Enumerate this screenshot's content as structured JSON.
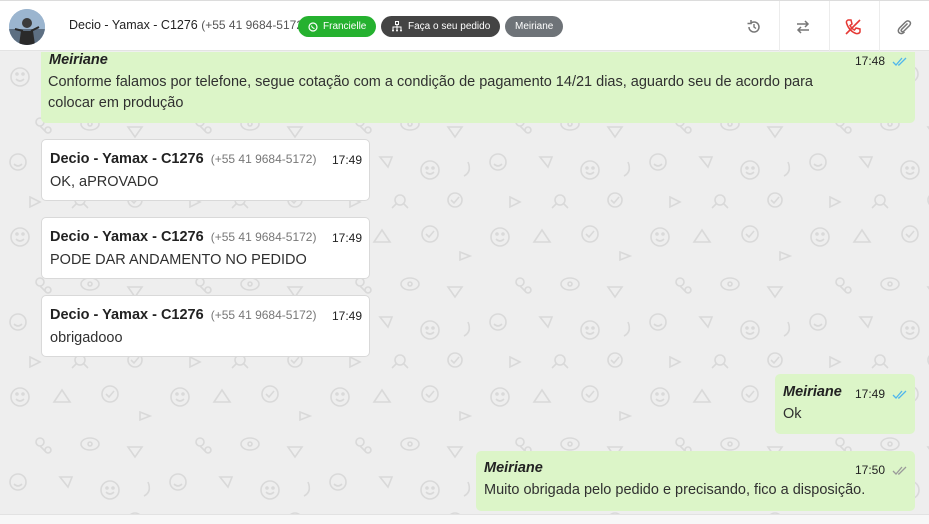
{
  "header": {
    "contact_name": "Decio - Yamax - C1276",
    "contact_phone": "(+55 41 9684-5172)",
    "tags": {
      "whatsapp_agent": "Francielle",
      "order_flow": "Faça o seu pedido",
      "assignee": "Meiriane"
    },
    "icons": [
      "history-icon",
      "transfer-icon",
      "end-call-icon",
      "attachment-icon"
    ]
  },
  "colors": {
    "outgoing_bubble": "#dcf5c8",
    "incoming_bubble": "#ffffff",
    "green_tag": "#25b12f",
    "read_ticks": "#4fb6ec",
    "end_call": "#e53935"
  },
  "messages": [
    {
      "direction": "out",
      "author": "Meiriane",
      "time": "17:48",
      "status": "read",
      "lines": [
        "Conforme falamos por telefone, segue cotação com a condição de pagamento 14/21 dias, aguardo seu de acordo para",
        "colocar em produção"
      ]
    },
    {
      "direction": "in",
      "author": "Decio - Yamax - C1276",
      "phone": "(+55 41 9684-5172)",
      "time": "17:49",
      "text": "OK, aPROVADO"
    },
    {
      "direction": "in",
      "author": "Decio - Yamax - C1276",
      "phone": "(+55 41 9684-5172)",
      "time": "17:49",
      "text": "PODE DAR ANDAMENTO NO PEDIDO"
    },
    {
      "direction": "in",
      "author": "Decio - Yamax - C1276",
      "phone": "(+55 41 9684-5172)",
      "time": "17:49",
      "text": "obrigadooo"
    },
    {
      "direction": "out",
      "author": "Meiriane",
      "time": "17:49",
      "status": "read",
      "text": "Ok"
    },
    {
      "direction": "out",
      "author": "Meiriane",
      "time": "17:50",
      "status": "delivered",
      "text": "Muito obrigada pelo pedido e precisando, fico a disposição."
    }
  ]
}
